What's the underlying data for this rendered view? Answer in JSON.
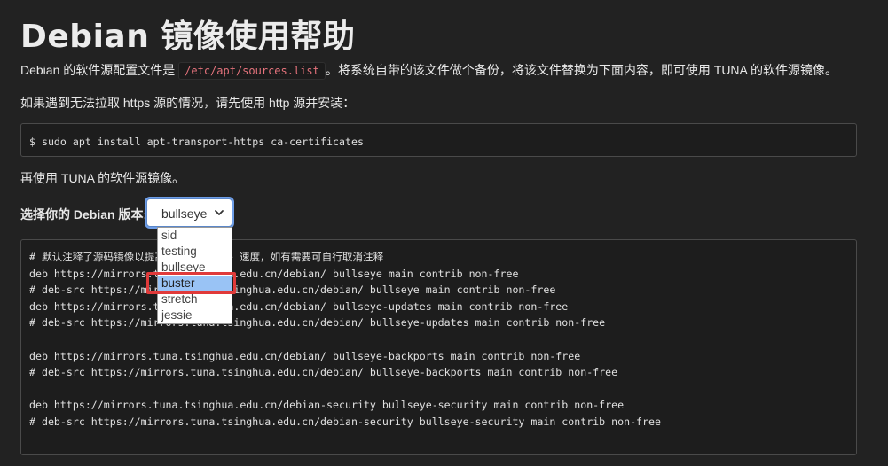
{
  "page": {
    "title": "Debian 镜像使用帮助",
    "intro_prefix": "Debian 的软件源配置文件是",
    "intro_code": "/etc/apt/sources.list",
    "intro_suffix": "。将系统自带的该文件做个备份，将该文件替换为下面内容，即可使用 TUNA 的软件源镜像。",
    "https_note": "如果遇到无法拉取 https 源的情况，请先使用 http 源并安装：",
    "install_cmd": "$ sudo apt install apt-transport-https ca-certificates",
    "use_tuna": "再使用 TUNA 的软件源镜像。",
    "version_label": "选择你的 Debian 版本:"
  },
  "version_select": {
    "value": "bullseye",
    "options": [
      "sid",
      "testing",
      "bullseye",
      "buster",
      "stretch",
      "jessie"
    ],
    "highlighted": "buster"
  },
  "sources": {
    "lines": [
      "# 默认注释了源码镜像以提高 apt update 速度，如有需要可自行取消注释",
      "deb https://mirrors.tuna.tsinghua.edu.cn/debian/ bullseye main contrib non-free",
      "# deb-src https://mirrors.tuna.tsinghua.edu.cn/debian/ bullseye main contrib non-free",
      "deb https://mirrors.tuna.tsinghua.edu.cn/debian/ bullseye-updates main contrib non-free",
      "# deb-src https://mirrors.tuna.tsinghua.edu.cn/debian/ bullseye-updates main contrib non-free",
      "",
      "deb https://mirrors.tuna.tsinghua.edu.cn/debian/ bullseye-backports main contrib non-free",
      "# deb-src https://mirrors.tuna.tsinghua.edu.cn/debian/ bullseye-backports main contrib non-free",
      "",
      "deb https://mirrors.tuna.tsinghua.edu.cn/debian-security bullseye-security main contrib non-free",
      "# deb-src https://mirrors.tuna.tsinghua.edu.cn/debian-security bullseye-security main contrib non-free"
    ]
  },
  "colors": {
    "background": "#222222",
    "code_bg": "#1d1d1d",
    "inline_code": "#e5737c",
    "option_highlight": "#99c3f5",
    "annotation_box": "#e03a3a"
  }
}
